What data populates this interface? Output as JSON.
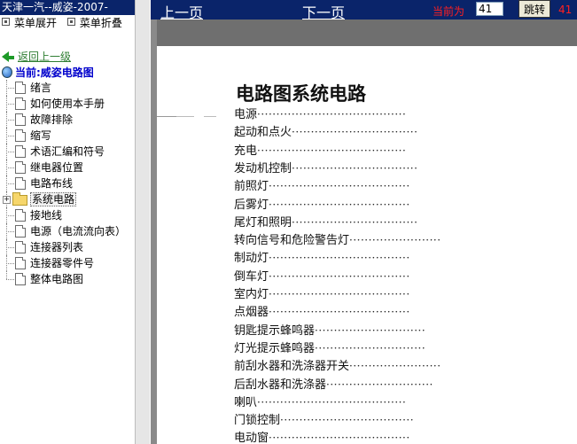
{
  "left": {
    "title": "天津一汽--威姿-2007-",
    "menu": {
      "expand": "菜单展开",
      "collapse": "菜单折叠"
    },
    "back": "返回上一级",
    "current": "当前:威姿电路图",
    "tree": [
      {
        "label": "绪言",
        "type": "doc"
      },
      {
        "label": "如何使用本手册",
        "type": "doc"
      },
      {
        "label": "故障排除",
        "type": "doc"
      },
      {
        "label": "缩写",
        "type": "doc"
      },
      {
        "label": "术语汇编和符号",
        "type": "doc"
      },
      {
        "label": "继电器位置",
        "type": "doc"
      },
      {
        "label": "电路布线",
        "type": "doc"
      },
      {
        "label": "系统电路",
        "type": "folder"
      },
      {
        "label": "接地线",
        "type": "doc"
      },
      {
        "label": "电源（电流流向表）",
        "type": "doc"
      },
      {
        "label": "连接器列表",
        "type": "doc"
      },
      {
        "label": "连接器零件号",
        "type": "doc"
      },
      {
        "label": "整体电路图",
        "type": "doc"
      }
    ]
  },
  "toolbar": {
    "prev": "上一页",
    "next": "下一页",
    "current_label": "当前为",
    "page_value": "41",
    "jump": "跳转",
    "total": "41"
  },
  "document": {
    "title": "电路图系统电路",
    "entries": [
      "电源",
      "起动和点火",
      "充电",
      "发动机控制",
      "前照灯",
      "后雾灯",
      "尾灯和照明",
      "转向信号和危险警告灯",
      "制动灯",
      "倒车灯",
      "室内灯",
      "点烟器",
      "钥匙提示蜂鸣器",
      "灯光提示蜂鸣器",
      "前刮水器和洗涤器开关",
      "后刮水器和洗涤器",
      "喇叭",
      "门锁控制",
      "电动窗"
    ]
  }
}
